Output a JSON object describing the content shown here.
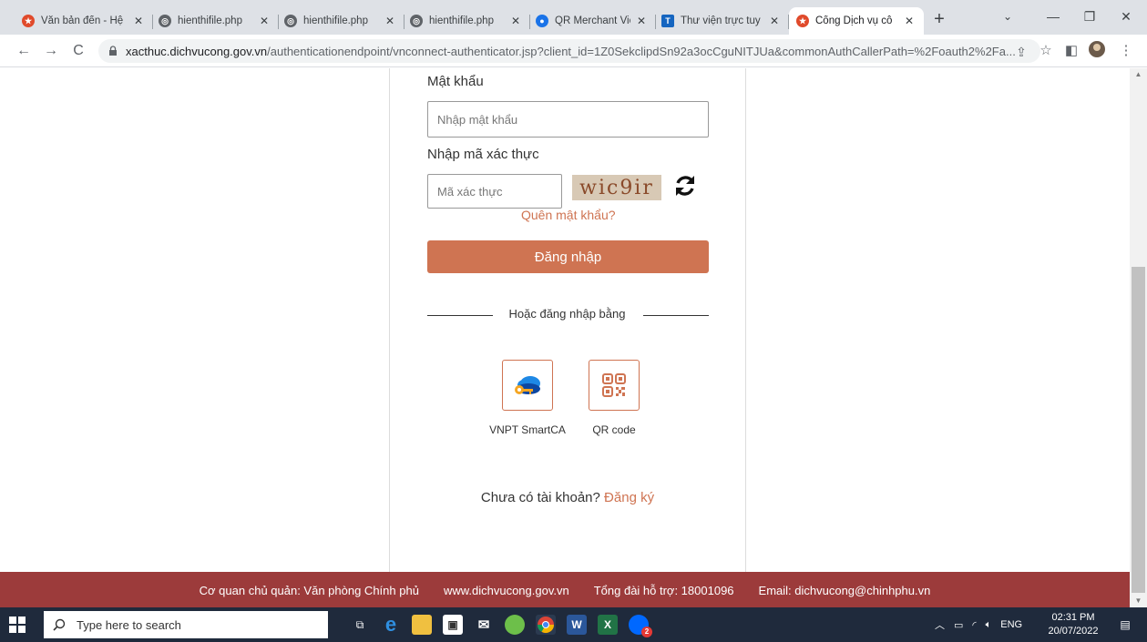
{
  "browser": {
    "tabs": [
      {
        "title": "Văn bản đến - Hệ",
        "favicon": "star-emblem-icon"
      },
      {
        "title": "hienthifile.php",
        "favicon": "globe-icon"
      },
      {
        "title": "hienthifile.php",
        "favicon": "globe-icon"
      },
      {
        "title": "hienthifile.php",
        "favicon": "globe-icon"
      },
      {
        "title": "QR Merchant Vie",
        "favicon": "qr-merchant-icon"
      },
      {
        "title": "Thư viện trực tuy",
        "favicon": "library-icon"
      },
      {
        "title": "Cổng Dịch vụ cô",
        "favicon": "star-emblem-icon",
        "active": true
      }
    ],
    "new_tab": "+",
    "url_host": "xacthuc.dichvucong.gov.vn",
    "url_path": "/authenticationendpoint/vnconnect-authenticator.jsp?client_id=1Z0SekclipdSn92a3ocCguNITJUa&commonAuthCallerPath=%2Foauth2%2Fa..."
  },
  "login": {
    "password_label": "Mật khẩu",
    "password_placeholder": "Nhập mật khẩu",
    "captcha_label": "Nhập mã xác thực",
    "captcha_placeholder": "Mã xác thực",
    "captcha_text": "wic9ir",
    "forgot_password": "Quên mật khẩu?",
    "login_button": "Đăng nhập",
    "alt_login_text": "Hoặc đăng nhập bằng",
    "alt_methods": [
      {
        "label": "VNPT SmartCA",
        "icon": "smartca-key-cloud-icon"
      },
      {
        "label": "QR code",
        "icon": "qr-code-icon"
      }
    ],
    "no_account": "Chưa có tài khoản?",
    "register": "Đăng ký"
  },
  "footer": {
    "agency": "Cơ quan chủ quản: Văn phòng Chính phủ",
    "website": "www.dichvucong.gov.vn",
    "hotline": "Tổng đài hỗ trợ: 18001096",
    "email": "Email: dichvucong@chinhphu.vn"
  },
  "taskbar": {
    "search_placeholder": "Type here to search",
    "language": "ENG",
    "time": "02:31 PM",
    "date": "20/07/2022",
    "zalo_badge": "2"
  },
  "colors": {
    "accent": "#cf7452",
    "footer_bg": "#9c3b3b",
    "taskbar_bg": "#1f2a3c"
  }
}
